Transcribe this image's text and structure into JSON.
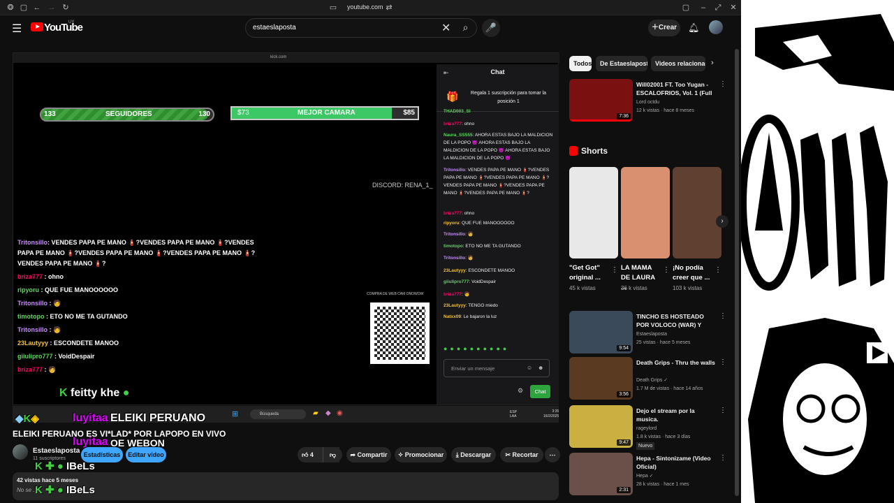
{
  "browser": {
    "url": "youtube.com"
  },
  "header": {
    "logo": "YouTube",
    "country": "UY",
    "search_value": "estaeslaposta",
    "create_label": "Crear"
  },
  "player": {
    "inner_url": "kick.com",
    "followers_bar": {
      "left": "133",
      "label": "SEGUIDORES",
      "right": "130",
      "fill": 0.97
    },
    "camera_bar": {
      "left": "$73",
      "label": "MEJOR CAMARA",
      "right": "$85",
      "fill": 0.86
    },
    "discord": "DISCORD: RENA_1_",
    "qr_caption": "COMPRA DE WEB CAM ONOWOW",
    "overlay_chat": [
      {
        "user": "Tritonsillo",
        "text": ": VENDES PAPA PE MANO 🧯?VENDES PAPA PE MANO 🧯?VENDES PAPA PE MANO 🧯?VENDES PAPA PE MANO 🧯?VENDES PAPA PE MANO 🧯?VENDES PAPA PE MANO 🧯?",
        "color": "u1"
      },
      {
        "user": "briza777",
        "text": " : ohno",
        "color": "u3"
      },
      {
        "user": "ripyoru",
        "text": " : QUE FUE MANOOOOOO",
        "color": "u2"
      },
      {
        "user": "Tritonsillo",
        "text": " : 🧑",
        "color": "u1"
      },
      {
        "user": "timotopo",
        "text": " : ETO NO ME TA GUTANDO",
        "color": "u2"
      },
      {
        "user": "Tritonsillo",
        "text": " : 🧑",
        "color": "u1"
      },
      {
        "user": "23Lautyyy",
        "text": " : ESCONDETE MANOO",
        "color": "u4"
      },
      {
        "user": "giiulipro777",
        "text": " : VoidDespair",
        "color": "u2"
      },
      {
        "user": "briza777",
        "text": " : 🧑",
        "color": "u3"
      }
    ],
    "feitty": "feitty khe"
  },
  "stream_chat": {
    "title": "Chat",
    "promo": "Regala 1 suscripción para tomar la posición 1",
    "messages": [
      {
        "user": "THAD003_SI",
        "text": ""
      },
      {
        "user": "briza777",
        "text": ": ohno"
      },
      {
        "user": "Naura_SS555",
        "text": ": AHORA ESTAS BAJO LA MALDICION DE LA POPO 😈 AHORA ESTAS BAJO LA MALDICION DE LA POPO 😈 AHORA ESTAS BAJO LA MALDICION DE LA POPO 😈"
      },
      {
        "user": "Tritonsillo",
        "text": ": VENDES PAPA PE MANO 🧯?VENDES PAPA PE MANO 🧯?VENDES PAPA PE MANO 🧯?VENDES PAPA PE MANO 🧯?VENDES PAPA PE MANO 🧯?VENDES PAPA PE MANO 🧯?"
      },
      {
        "user": "briza777",
        "text": ": ohno"
      },
      {
        "user": "ripyoru",
        "text": ": QUE FUE MANOOOOOO"
      },
      {
        "user": "Tritonsillo",
        "text": ": 🧑"
      },
      {
        "user": "timotopo",
        "text": ": ETO NO ME TA GUTANDO"
      },
      {
        "user": "Tritonsillo",
        "text": ": 🧑"
      },
      {
        "user": "23Lautyyy",
        "text": ": ESCONDETE MANOO"
      },
      {
        "user": "giiulipro777",
        "text": ": VoidDespair"
      },
      {
        "user": "briza777",
        "text": ": 🧑"
      },
      {
        "user": "23Lautyyy",
        "text": ": TENGO miedo"
      },
      {
        "user": "Natxx09",
        "text": ": Le bajaron la luz"
      }
    ],
    "input_placeholder": "Enviar un mensaje",
    "send_label": "Chat"
  },
  "taskbar": {
    "search": "Búsqueda",
    "lang": "ESP\nLAA",
    "time": "3:35",
    "date": "16/2/2025"
  },
  "overlay_names": {
    "top": "luyitaa",
    "mid": "ELEIKI PERUANO",
    "bottom": "luyitaa",
    "bottom2": "OE WEBON",
    "ibels": "IBeLs"
  },
  "video": {
    "title": "ELEIKI PERUANO ES VI*LAD* POR LAPOPO EN VIVO",
    "channel": "Estaeslaposta",
    "subs": "11 suscriptores",
    "stats_label": "Estadísticas",
    "edit_label": "Editar video",
    "likes": "4",
    "share": "Compartir",
    "promote": "Promocionar",
    "download": "Descargar",
    "clip": "Recortar",
    "views": "42 vistas  hace 5 meses",
    "desc_more": "No se ..."
  },
  "chips": [
    "Todos",
    "De Estaeslaposta",
    "Videos relacionados"
  ],
  "related": [
    {
      "title": "Will02001 FT. Too Yugan - ESCALOFRIOS, Vol. 1 (Full EP)",
      "channel": "Lord octdu",
      "meta": "12 k vistas · hace 8 meses",
      "dur": "7:36",
      "bg": "#7a1010"
    },
    {
      "title": "TINCHO ES HOSTEADO POR VOLOCO (WAR) Y HACE 120 ...",
      "channel": "Estaeslaposta",
      "meta": "25 vistas · hace 5 meses",
      "dur": "9:54",
      "bg": "#3a4a5a"
    },
    {
      "title": "Death Grips - Thru the walls",
      "channel": "Death Grips ✓",
      "meta": "1.7 M de vistas · hace 14 años",
      "dur": "3:56",
      "bg": "#5a3a20"
    },
    {
      "title": "Dejo el stream por la musica.",
      "channel": "rageylord",
      "meta": "1.8 k vistas · hace 3 días",
      "dur": "9:47",
      "bg": "#c9b040",
      "badge": "Nuevo"
    },
    {
      "title": "Hepa - Sintonizame (Video Oficial)",
      "channel": "Hepa ✓",
      "meta": "28 k vistas · hace 1 mes",
      "dur": "2:31",
      "bg": "#6a5048"
    }
  ],
  "shorts_title": "Shorts",
  "shorts": [
    {
      "title": "\"Get Got\" original ...",
      "views": "45 k vistas",
      "bg": "#e8e8e8"
    },
    {
      "title": "LA MAMA DE LAURA ...",
      "views": "36 k vistas",
      "bg": "#d89070"
    },
    {
      "title": "¡No podía creer que ...",
      "views": "103 k vistas",
      "bg": "#604030"
    }
  ]
}
